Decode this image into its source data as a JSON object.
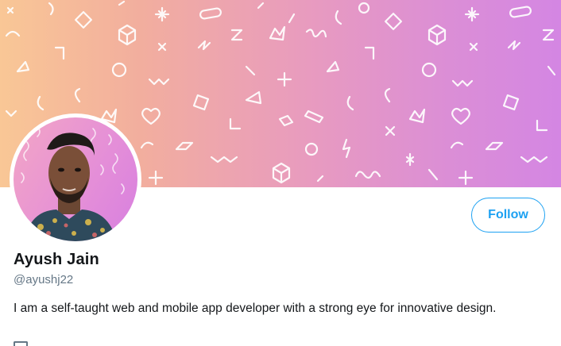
{
  "profile": {
    "name": "Ayush Jain",
    "handle": "@ayushj22",
    "bio": "I am a self-taught web and mobile app developer with a strong eye for innovative design."
  },
  "actions": {
    "follow_label": "Follow"
  },
  "colors": {
    "accent": "#1da1f2",
    "text_primary": "#14171a",
    "text_secondary": "#657786",
    "banner_gradient_start": "#f9c796",
    "banner_gradient_end": "#d486e3"
  },
  "icons": {
    "banner_pattern": "doodle-pattern",
    "meta": "calendar-icon"
  }
}
